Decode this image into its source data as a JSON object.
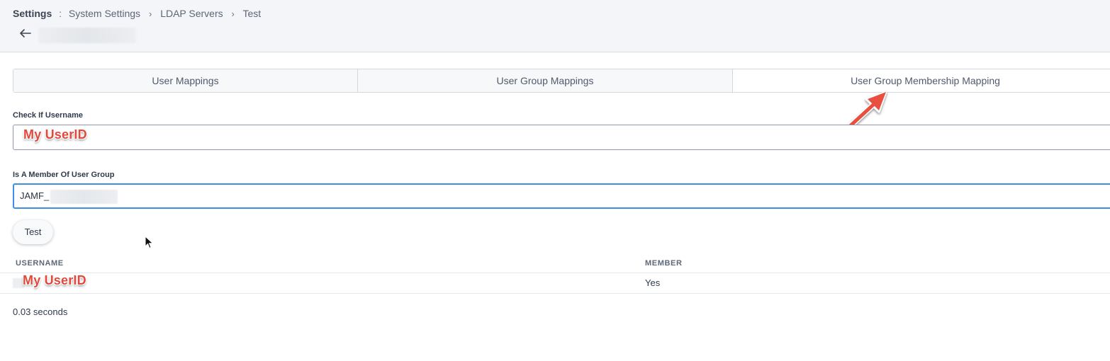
{
  "breadcrumb": {
    "root": "Settings",
    "separator": ":",
    "items": [
      "System Settings",
      "LDAP Servers",
      "Test"
    ]
  },
  "tabs": [
    {
      "label": "User Mappings",
      "active": false
    },
    {
      "label": "User Group Mappings",
      "active": false
    },
    {
      "label": "User Group Membership Mapping",
      "active": true
    }
  ],
  "form": {
    "username_label": "Check If Username",
    "username_annotation": "My UserID",
    "group_label": "Is A Member Of User Group",
    "group_value": "JAMF_",
    "test_button_label": "Test"
  },
  "results": {
    "columns": [
      "USERNAME",
      "MEMBER"
    ],
    "rows": [
      {
        "username_annotation": "My UserID",
        "member": "Yes"
      }
    ],
    "elapsed": "0.03 seconds"
  },
  "colors": {
    "annotation_red": "#e2483b",
    "focus_blue": "#3c8ee8",
    "header_bg": "#f4f5f8"
  },
  "icons": {
    "back": "arrow-left-icon",
    "annotation_arrow": "annotation-arrow-icon",
    "cursor": "mouse-cursor-icon"
  }
}
